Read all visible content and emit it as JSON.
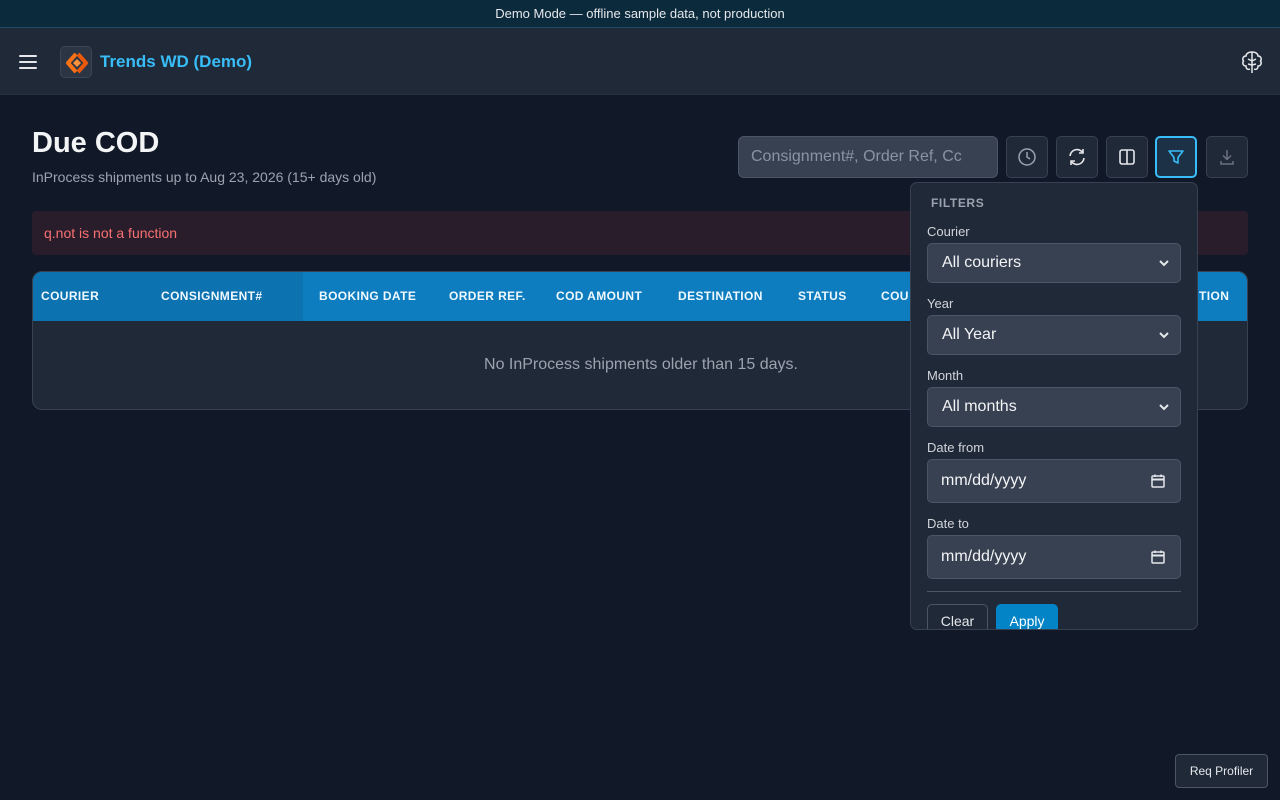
{
  "banner": {
    "text": "Demo Mode — offline sample data, not production"
  },
  "header": {
    "app_title": "Trends WD (Demo)",
    "menu_icon": "hamburger-menu-icon",
    "logo_icon": "app-logo-icon",
    "brain_icon": "brain-icon"
  },
  "page": {
    "title": "Due COD",
    "subtitle": "InProcess shipments up to Aug 23, 2026 (15+ days old)"
  },
  "toolbar": {
    "search_placeholder": "Consignment#, Order Ref, Cc",
    "buttons": [
      {
        "icon": "history-clock-icon"
      },
      {
        "icon": "refresh-icon"
      },
      {
        "icon": "columns-icon"
      },
      {
        "icon": "filter-funnel-icon",
        "active": true
      },
      {
        "icon": "download-icon"
      }
    ]
  },
  "error": {
    "message": "q.not is not a function"
  },
  "table": {
    "columns": [
      "COURIER",
      "CONSIGNMENT#",
      "BOOKING DATE",
      "ORDER REF.",
      "COD AMOUNT",
      "DESTINATION",
      "STATUS",
      "COU",
      "TION"
    ],
    "empty_message": "No InProcess shipments older than 15 days."
  },
  "filters": {
    "heading": "FILTERS",
    "courier": {
      "label": "Courier",
      "value": "All couriers"
    },
    "year": {
      "label": "Year",
      "value": "All Year"
    },
    "month": {
      "label": "Month",
      "value": "All months"
    },
    "date_from": {
      "label": "Date from",
      "value": "mm/dd/yyyy"
    },
    "date_to": {
      "label": "Date to",
      "value": "mm/dd/yyyy"
    },
    "clear_label": "Clear",
    "apply_label": "Apply"
  },
  "req_profiler": {
    "label": "Req Profiler"
  },
  "colors": {
    "accent": "#38bdf8",
    "header_row": "#0e7dc0",
    "error_text": "#f87171",
    "apply_button": "#0284c7"
  }
}
